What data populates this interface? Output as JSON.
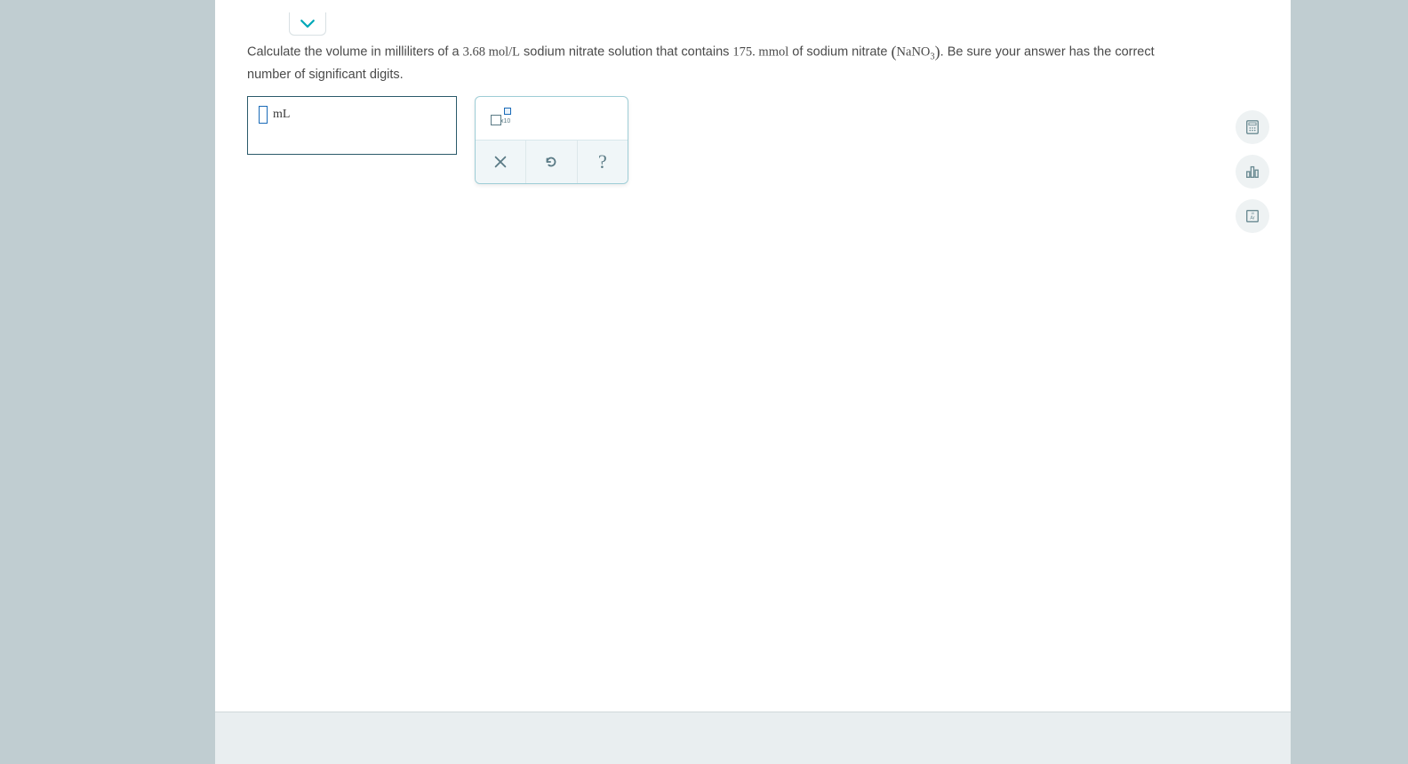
{
  "question": {
    "text_before_conc": "Calculate the volume in milliliters of a ",
    "concentration": "3.68",
    "conc_unit": " mol/L",
    "text_mid1": " sodium nitrate solution that contains ",
    "amount": "175.",
    "amount_unit": " mmol",
    "text_mid2": " of sodium nitrate ",
    "formula_na": "NaNO",
    "formula_sub": "3",
    "text_after": ". Be sure your answer has the correct number of significant digits."
  },
  "answer": {
    "unit": "mL",
    "value": ""
  },
  "tools": {
    "sci_notation_x10": "x10",
    "clear_label": "×",
    "reset_label": "↺",
    "help_label": "?"
  },
  "side": {
    "calculator": "calculator-icon",
    "stats": "bar-chart-icon",
    "periodic": "periodic-table-icon",
    "periodic_text": "Ar"
  }
}
